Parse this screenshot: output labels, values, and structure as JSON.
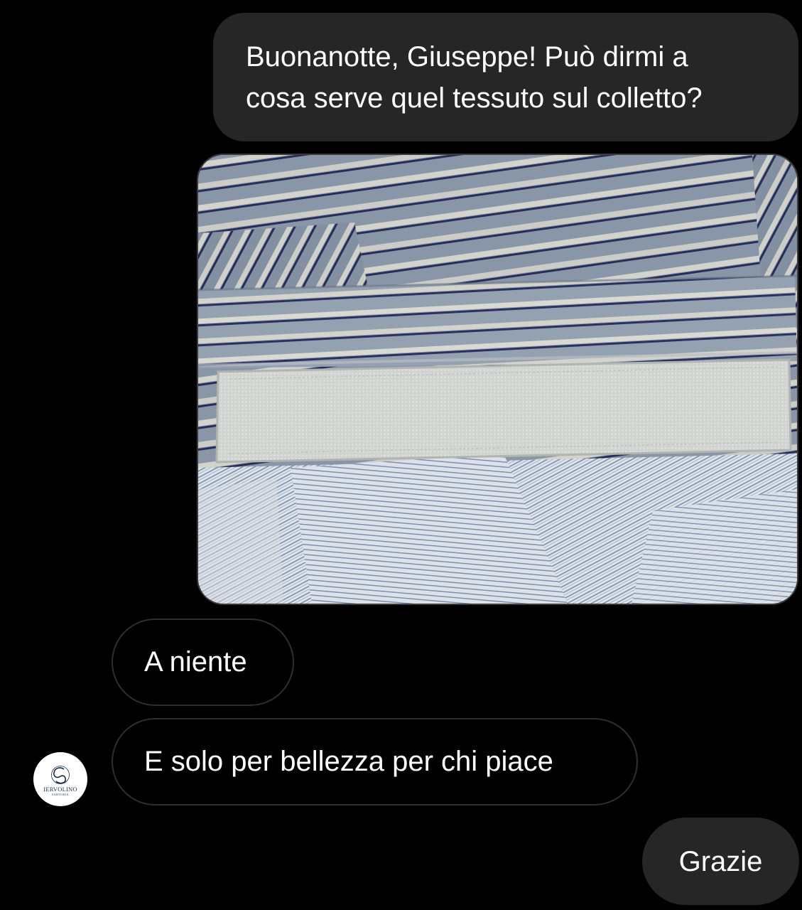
{
  "conversation": {
    "messages": [
      {
        "sender": "me",
        "type": "text",
        "text": "Buonanotte, Giuseppe! Può dirmi a\ncosa serve quel tessuto sul colletto?"
      },
      {
        "sender": "me",
        "type": "photo",
        "subject": "shirt-collar-photo"
      },
      {
        "sender": "other",
        "type": "text",
        "text": "A niente"
      },
      {
        "sender": "other",
        "type": "text",
        "text": "E solo per bellezza per chi piace"
      },
      {
        "sender": "me",
        "type": "text",
        "text": "Grazie"
      }
    ]
  },
  "contact": {
    "avatar_icon": "iervolino-logo-icon",
    "avatar_logo_text": "IERVOLINO",
    "avatar_logo_subtext": "SARTORIA"
  },
  "colors": {
    "background": "#000000",
    "outgoing_bubble": "#262626",
    "incoming_border": "#2f2f2f",
    "text": "#ffffff"
  }
}
